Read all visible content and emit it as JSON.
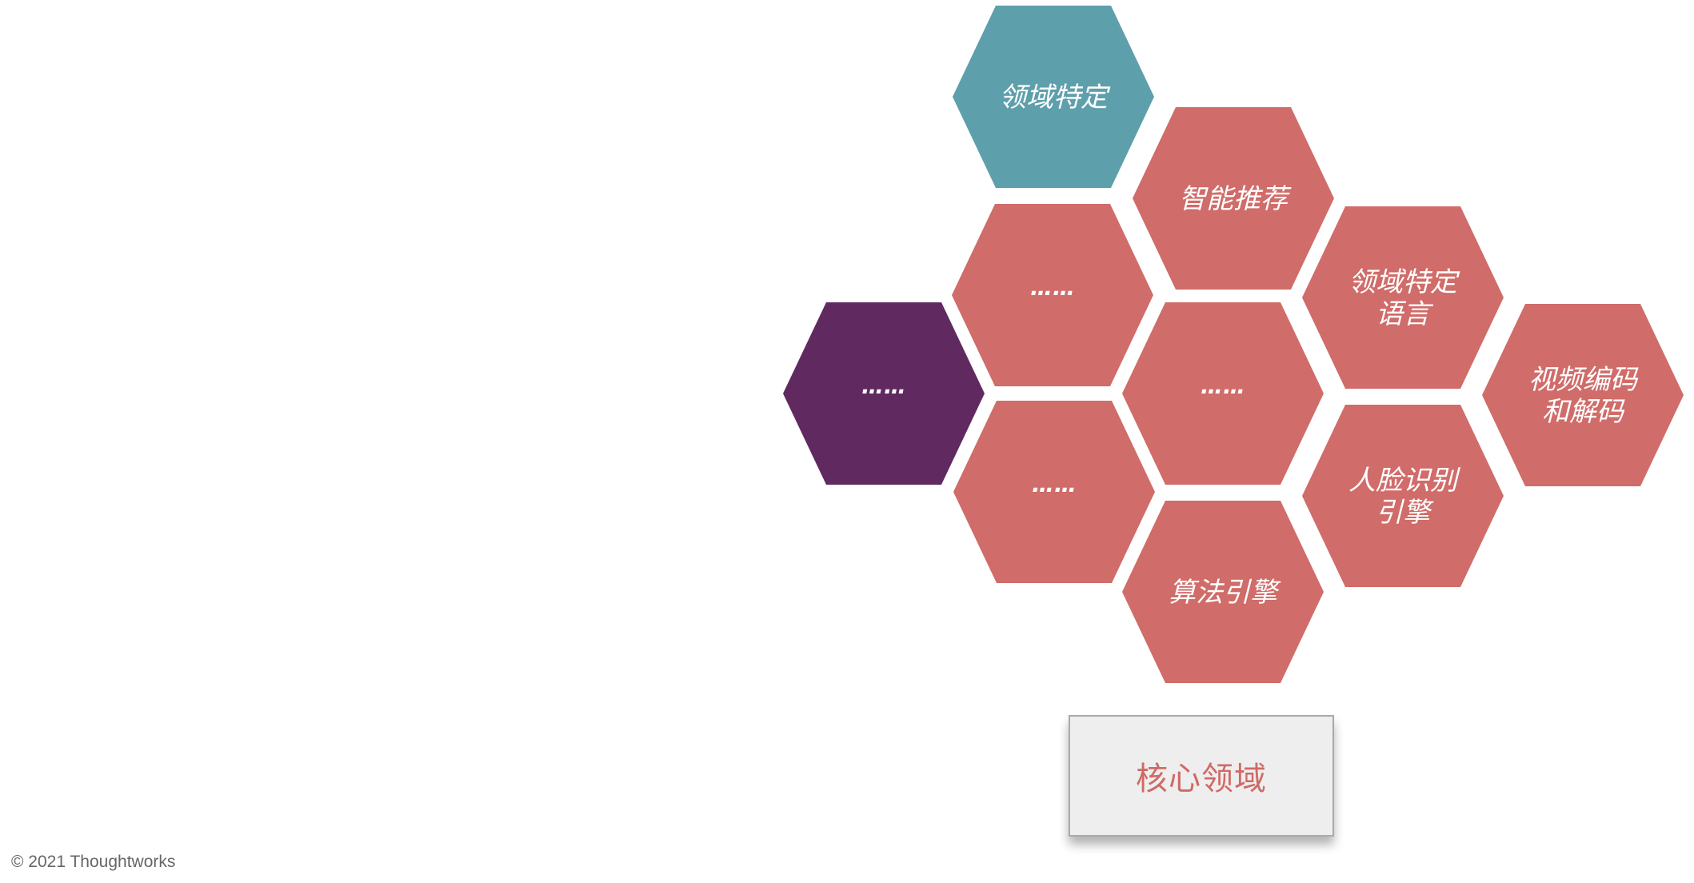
{
  "colors": {
    "teal": "#5e9fac",
    "coral": "#d06c69",
    "purple": "#602960",
    "core_label": "#d06a66",
    "box_bg": "#eeeeee"
  },
  "hexagons": [
    {
      "id": "domain-specific",
      "label": [
        "领域特定"
      ],
      "color": "teal"
    },
    {
      "id": "smart-recommendation",
      "label": [
        "智能推荐"
      ],
      "color": "coral"
    },
    {
      "id": "ellipsis-upper",
      "label": [
        "……"
      ],
      "color": "coral"
    },
    {
      "id": "dsl",
      "label": [
        "领域特定",
        "语言"
      ],
      "color": "coral"
    },
    {
      "id": "ellipsis-left",
      "label": [
        "……"
      ],
      "color": "purple"
    },
    {
      "id": "ellipsis-center",
      "label": [
        "……"
      ],
      "color": "coral"
    },
    {
      "id": "video-codec",
      "label": [
        "视频编码",
        "和解码"
      ],
      "color": "coral"
    },
    {
      "id": "ellipsis-lower",
      "label": [
        "……"
      ],
      "color": "coral"
    },
    {
      "id": "face-recognition",
      "label": [
        "人脸识别",
        "引擎"
      ],
      "color": "coral"
    },
    {
      "id": "algorithm-engine",
      "label": [
        "算法引擎"
      ],
      "color": "coral"
    }
  ],
  "core_domain": {
    "label": "核心领域"
  },
  "footer": {
    "copyright": "© 2021 Thoughtworks"
  }
}
